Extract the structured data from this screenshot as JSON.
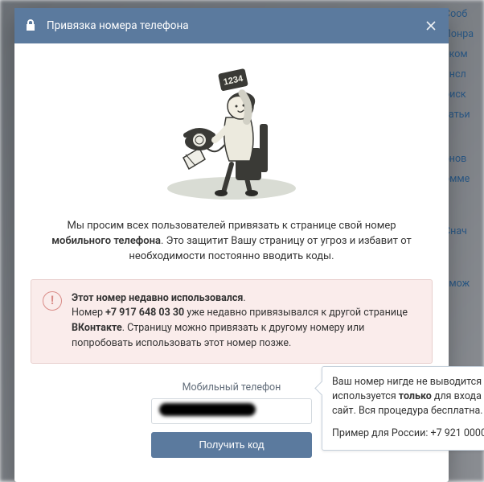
{
  "header": {
    "title": "Привязка номера телефона"
  },
  "intro": {
    "prefix": "Мы просим всех пользователей привязать к странице свой номер ",
    "bold1": "мобильного телефона",
    "suffix": ". Это защитит Вашу страницу от угроз и избавит от необходимости постоянно вводить коды."
  },
  "warning": {
    "line1_bold": "Этот номер недавно использовался",
    "line2_prefix": "Номер ",
    "line2_number": "+7 917 648 03 30",
    "line2_mid": " уже недавно привязывался к другой странице ",
    "line2_brand": "ВКонтакте",
    "line2_suffix": ". Страницу можно привязать к другому номеру или попробовать использовать этот номер позже."
  },
  "form": {
    "label": "Мобильный телефон",
    "value": "",
    "submit": "Получить код"
  },
  "tooltip": {
    "p1_prefix": "Ваш номер нигде не выводится",
    "p1_mid": " используется ",
    "p1_bold": "только",
    "p1_suffix": " для входа",
    "p1_tail": " сайт. Вся процедура бесплатна.",
    "p2": "Пример для России: +7 921 0000"
  },
  "bg_items": [
    "Сооб",
    "Понра",
    "еком",
    "ансл",
    "оиск",
    "татьи",
    "бнов",
    "омме",
    "Снач",
    "змож"
  ]
}
